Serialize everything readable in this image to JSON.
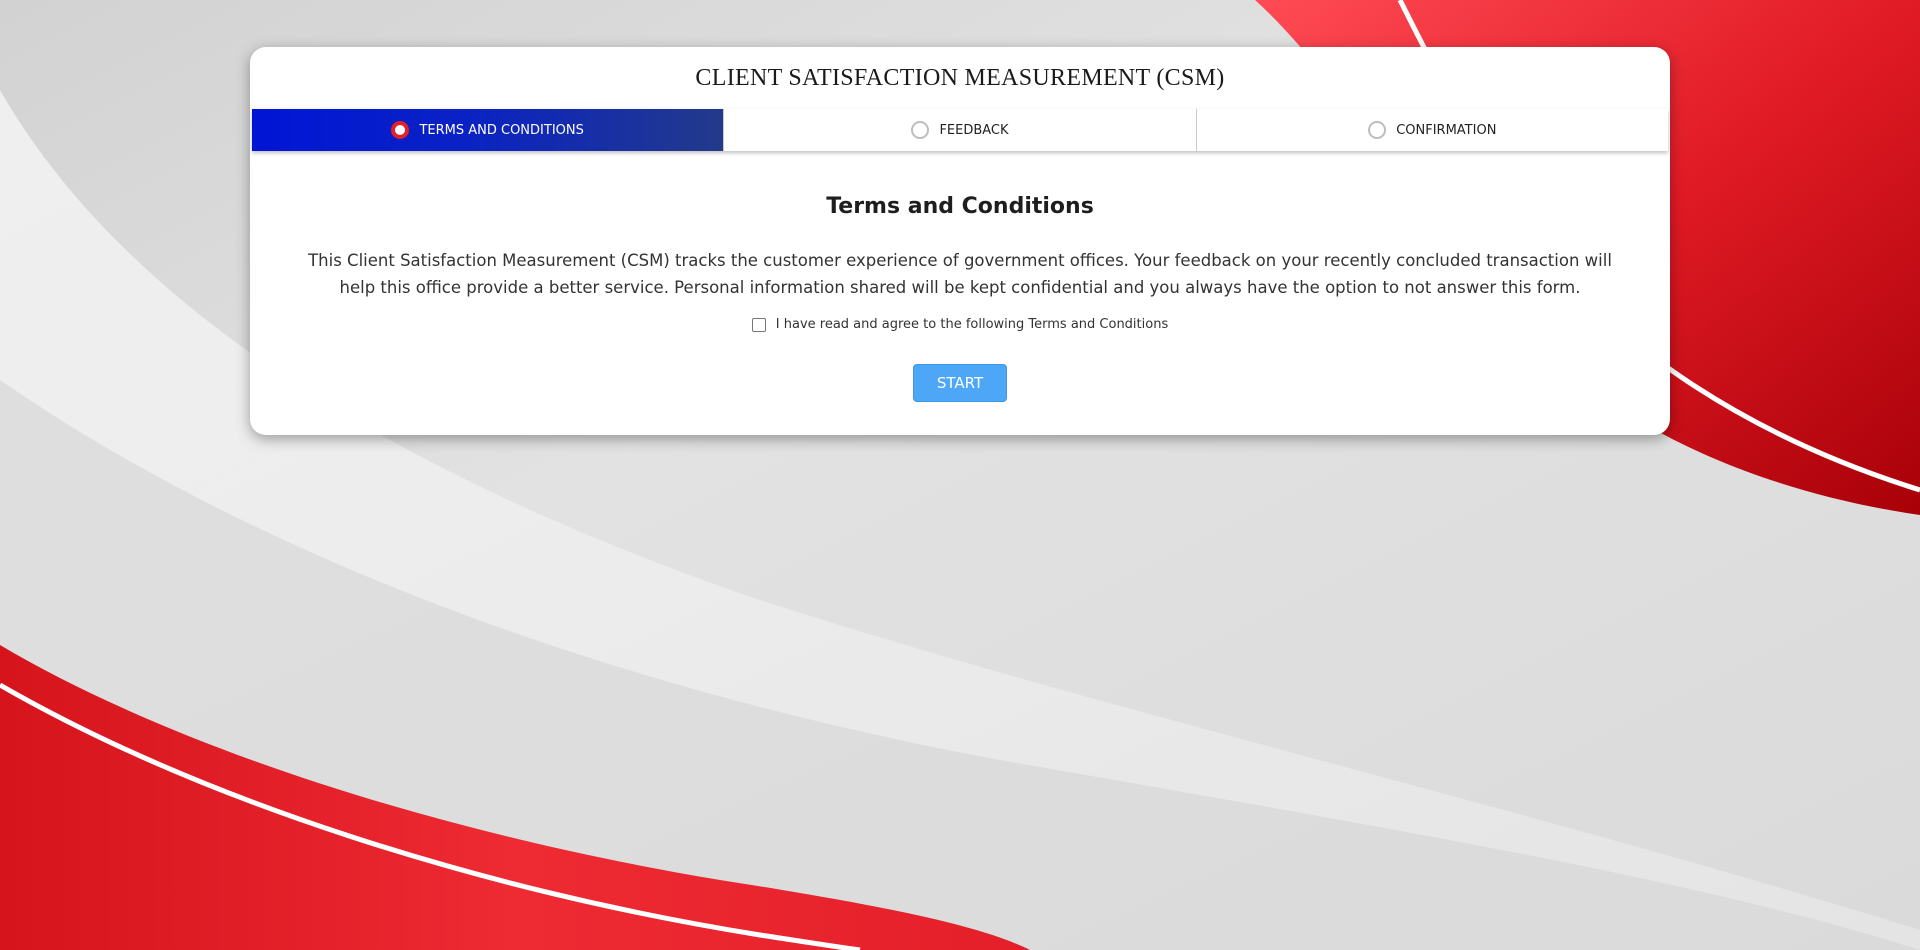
{
  "page": {
    "title": "CLIENT SATISFACTION MEASUREMENT (CSM)"
  },
  "steps": [
    {
      "label": "TERMS AND CONDITIONS",
      "active": true
    },
    {
      "label": "FEEDBACK",
      "active": false
    },
    {
      "label": "CONFIRMATION",
      "active": false
    }
  ],
  "terms": {
    "heading": "Terms and Conditions",
    "body": "This Client Satisfaction Measurement (CSM) tracks the customer experience of government offices. Your feedback on your recently concluded transaction will help this office provide a better service. Personal information shared will be kept confidential and you always have the option to not answer this form.",
    "agree_label": "I have read and agree to the following Terms and Conditions",
    "agree_checked": false,
    "start_label": "START"
  },
  "colors": {
    "active_step_start": "#0015d6",
    "active_step_end": "#233a8a",
    "active_radio": "#e0202a",
    "start_button": "#4ea6f7",
    "background_red": "#e11b25",
    "background_gray": "#dcdcdc"
  }
}
